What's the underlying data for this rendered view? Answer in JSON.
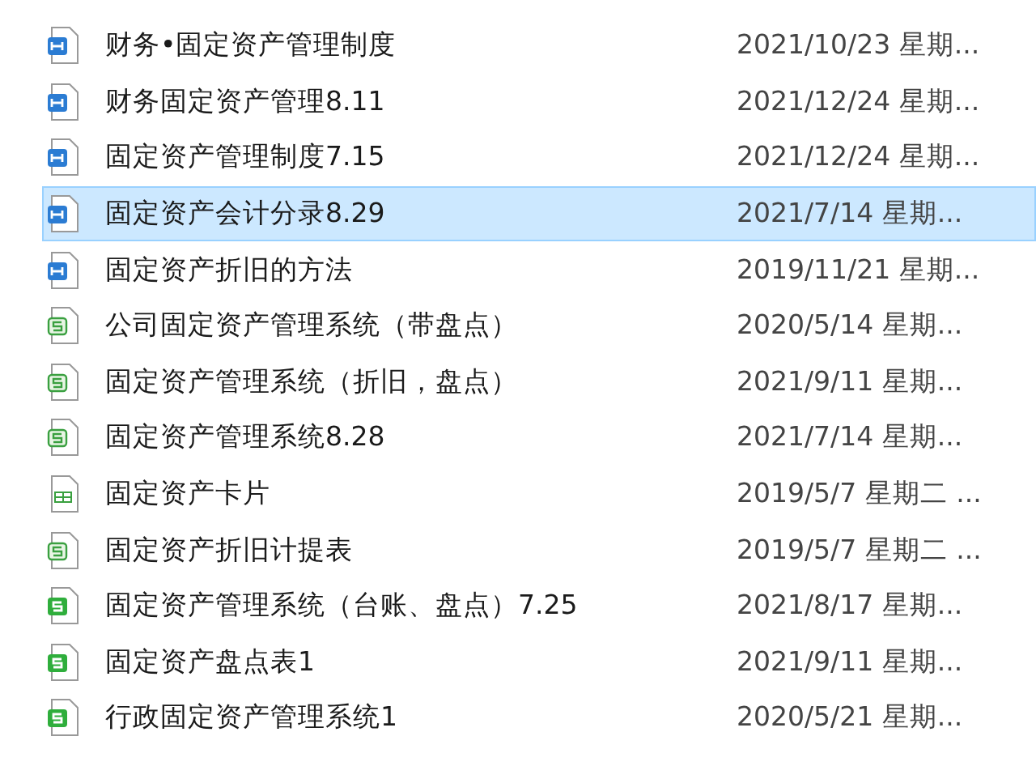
{
  "files": [
    {
      "kind": "doc",
      "name": "财务•固定资产管理制度",
      "date": "2021/10/23 星期...",
      "selected": false
    },
    {
      "kind": "doc",
      "name": "财务固定资产管理8.11",
      "date": "2021/12/24 星期...",
      "selected": false
    },
    {
      "kind": "doc",
      "name": "固定资产管理制度7.15",
      "date": "2021/12/24 星期...",
      "selected": false
    },
    {
      "kind": "doc",
      "name": "固定资产会计分录8.29",
      "date": "2021/7/14 星期...",
      "selected": true
    },
    {
      "kind": "doc",
      "name": "固定资产折旧的方法",
      "date": "2019/11/21 星期...",
      "selected": false
    },
    {
      "kind": "sheet",
      "name": "公司固定资产管理系统（带盘点）",
      "date": "2020/5/14 星期...",
      "selected": false
    },
    {
      "kind": "sheet",
      "name": "固定资产管理系统（折旧，盘点）",
      "date": "2021/9/11 星期...",
      "selected": false
    },
    {
      "kind": "sheet",
      "name": "固定资产管理系统8.28",
      "date": "2021/7/14 星期...",
      "selected": false
    },
    {
      "kind": "table",
      "name": "固定资产卡片",
      "date": "2019/5/7 星期二 ...",
      "selected": false
    },
    {
      "kind": "sheet",
      "name": "固定资产折旧计提表",
      "date": "2019/5/7 星期二 ...",
      "selected": false
    },
    {
      "kind": "sheetSolid",
      "name": "固定资产管理系统（台账、盘点）7.25",
      "date": "2021/8/17 星期...",
      "selected": false
    },
    {
      "kind": "sheetSolid",
      "name": "固定资产盘点表1",
      "date": "2021/9/11 星期...",
      "selected": false
    },
    {
      "kind": "sheetSolid",
      "name": "行政固定资产管理系统1",
      "date": "2020/5/21 星期...",
      "selected": false
    }
  ]
}
